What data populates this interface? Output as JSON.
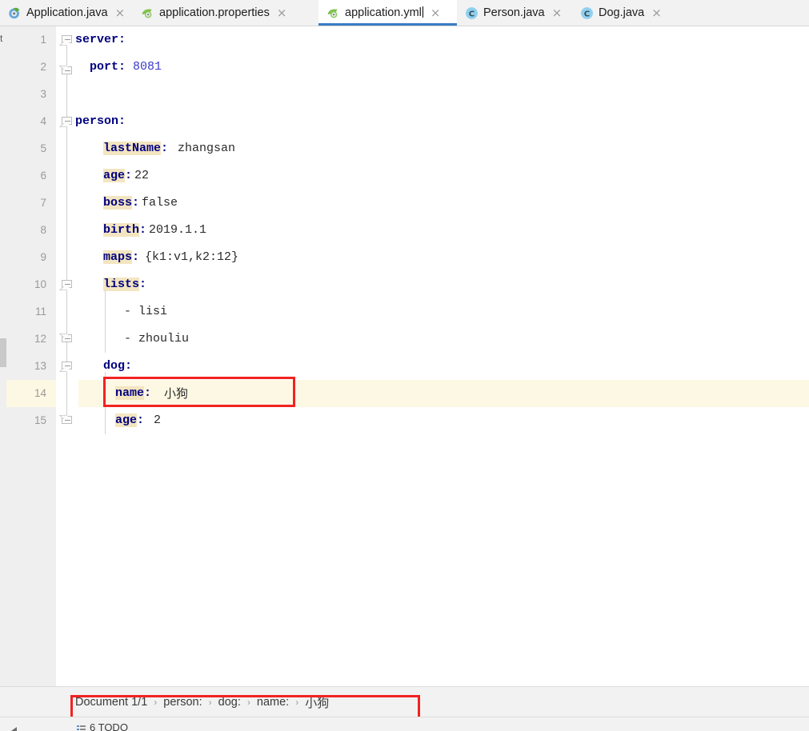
{
  "tabs": [
    {
      "label": "Application.java",
      "icon": "spring-boot-run-icon",
      "active": false,
      "close": "×"
    },
    {
      "label": "application.properties",
      "icon": "spring-leaf-icon",
      "active": false,
      "close": "×"
    },
    {
      "label": "application.yml",
      "icon": "spring-leaf-icon",
      "active": true,
      "close": "×"
    },
    {
      "label": "Person.java",
      "icon": "java-class-icon",
      "active": false,
      "close": "×"
    },
    {
      "label": "Dog.java",
      "icon": "java-class-icon",
      "active": false,
      "close": "×"
    }
  ],
  "left_rail": {
    "label": "t"
  },
  "editor": {
    "filename": "application.yml",
    "current_line": 14,
    "lines": [
      {
        "n": "1",
        "indent": 0,
        "key": "server",
        "sep": ":",
        "value": "",
        "type": "mapping",
        "fold": "down"
      },
      {
        "n": "2",
        "indent": 1,
        "key": "port",
        "sep": ":",
        "value": "8081",
        "type": "number",
        "fold": "up"
      },
      {
        "n": "3",
        "indent": 0,
        "key": "",
        "sep": "",
        "value": "",
        "type": "blank",
        "fold": ""
      },
      {
        "n": "4",
        "indent": 0,
        "key": "person",
        "sep": ":",
        "value": "",
        "type": "mapping",
        "fold": "down"
      },
      {
        "n": "5",
        "indent": 2,
        "key": "lastName",
        "sep": ":",
        "value": "zhangsan",
        "type": "scalar",
        "fold": ""
      },
      {
        "n": "6",
        "indent": 2,
        "key": "age",
        "sep": ":",
        "value": "22",
        "type": "scalar",
        "fold": ""
      },
      {
        "n": "7",
        "indent": 2,
        "key": "boss",
        "sep": ":",
        "value": "false",
        "type": "scalar",
        "fold": ""
      },
      {
        "n": "8",
        "indent": 2,
        "key": "birth",
        "sep": ":",
        "value": "2019.1.1",
        "type": "scalar",
        "fold": ""
      },
      {
        "n": "9",
        "indent": 2,
        "key": "maps",
        "sep": ":",
        "value": "{k1:v1,k2:12}",
        "type": "scalar",
        "fold": ""
      },
      {
        "n": "10",
        "indent": 2,
        "key": "lists",
        "sep": ":",
        "value": "",
        "type": "mapping",
        "fold": "down"
      },
      {
        "n": "11",
        "indent": 3,
        "key": "",
        "sep": "",
        "value": "- lisi",
        "type": "seq",
        "fold": ""
      },
      {
        "n": "12",
        "indent": 3,
        "key": "",
        "sep": "",
        "value": "- zhouliu",
        "type": "seq",
        "fold": "up"
      },
      {
        "n": "13",
        "indent": 2,
        "key": "dog",
        "sep": ":",
        "value": "",
        "type": "mapping-plain",
        "fold": "down"
      },
      {
        "n": "14",
        "indent": 3,
        "key": "name",
        "sep": ":",
        "value": "小狗",
        "type": "cjk",
        "fold": ""
      },
      {
        "n": "15",
        "indent": 3,
        "key": "age",
        "sep": ":",
        "value": "2",
        "type": "scalar",
        "fold": "up"
      }
    ]
  },
  "annotations": [
    {
      "name": "code-name-line-highlight"
    },
    {
      "name": "breadcrumb-highlight"
    }
  ],
  "breadcrumb": {
    "items": [
      {
        "label": "Document 1/1",
        "cjk": false
      },
      {
        "label": "person:",
        "cjk": false
      },
      {
        "label": "dog:",
        "cjk": false
      },
      {
        "label": "name:",
        "cjk": false
      },
      {
        "label": "小狗",
        "cjk": true
      }
    ],
    "separator": "›"
  },
  "status": {
    "left_label": "6 TODO",
    "run_label": ""
  },
  "colors": {
    "accent": "#3a7cc4",
    "annotation": "#f32222",
    "key_highlight": "#f3e5c0",
    "current_line": "#fdf8e3",
    "key_text": "#000080",
    "gutter": "#efefef"
  }
}
